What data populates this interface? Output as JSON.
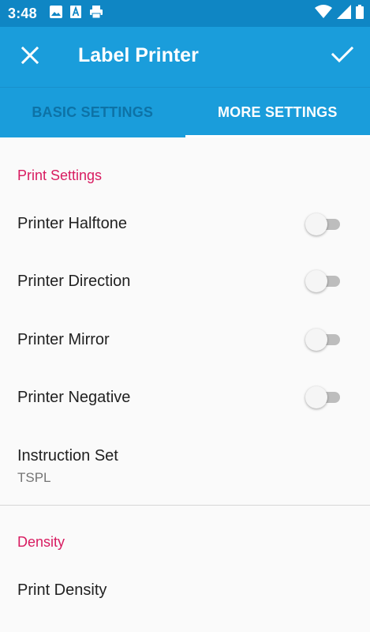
{
  "status_bar": {
    "time": "3:48",
    "left_icons": [
      "image-icon",
      "text-a-icon",
      "printer-icon"
    ],
    "right_icons": [
      "wifi-icon",
      "signal-icon",
      "battery-icon"
    ]
  },
  "app_bar": {
    "title": "Label Printer",
    "close_icon": "close-icon",
    "confirm_icon": "check-icon",
    "background": "#1a9ddb"
  },
  "tabs": [
    {
      "label": "BASIC SETTINGS",
      "selected": false
    },
    {
      "label": "MORE SETTINGS",
      "selected": true
    }
  ],
  "sections": [
    {
      "header": "Print Settings",
      "items": [
        {
          "label": "Printer Halftone",
          "type": "switch",
          "on": false
        },
        {
          "label": "Printer Direction",
          "type": "switch",
          "on": false
        },
        {
          "label": "Printer Mirror",
          "type": "switch",
          "on": false
        },
        {
          "label": "Printer Negative",
          "type": "switch",
          "on": false
        },
        {
          "label": "Instruction Set",
          "summary": "TSPL",
          "type": "list"
        }
      ]
    },
    {
      "header": "Density",
      "items": [
        {
          "label": "Print Density",
          "type": "preference"
        }
      ]
    }
  ],
  "colors": {
    "accent": "#d81b60",
    "primary": "#1a9ddb",
    "status_bar": "#0f86c4",
    "inactive_tab_text": "#0d72a6"
  }
}
